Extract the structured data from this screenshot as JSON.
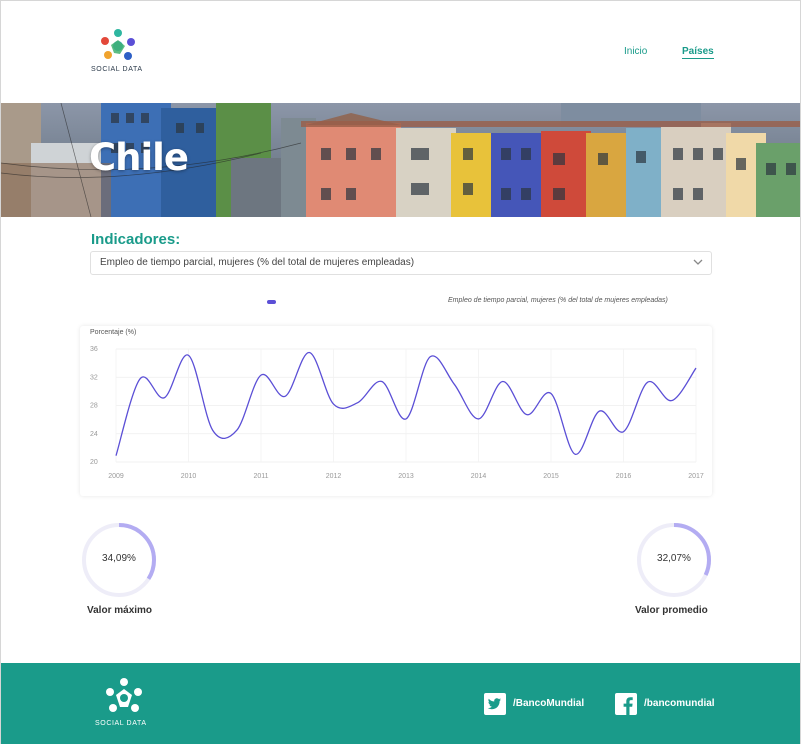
{
  "brand": {
    "logo_text": "SOCIAL DATA",
    "accent": "#1a9b8a",
    "line_color": "#5b4fd6",
    "gauge_color": "#b3acf2"
  },
  "nav": {
    "inicio": "Inicio",
    "paises": "Países"
  },
  "hero": {
    "title": "Chile"
  },
  "indicators": {
    "label": "Indicadores:",
    "selected": "Empleo de tiempo parcial, mujeres (% del total de mujeres empleadas)",
    "dropdown_icon": "chevron-down-icon"
  },
  "chart_data": {
    "type": "line",
    "ylabel": "Porcentaje (%)",
    "ylim": [
      20,
      36
    ],
    "y_ticks": [
      "36",
      "32",
      "28",
      "24",
      "20"
    ],
    "x_ticks": [
      "2009",
      "2010",
      "2011",
      "2012",
      "2013",
      "2014",
      "2015",
      "2016",
      "2017"
    ],
    "grid": true,
    "legend": "top",
    "series": [
      {
        "name": "Empleo de tiempo parcial, mujeres (% del total de mujeres empleadas)",
        "values": [
          20.9,
          31.8,
          29.1,
          35.1,
          24.5,
          24.5,
          32.3,
          29.3,
          35.5,
          28.2,
          28.4,
          31.4,
          26.1,
          34.9,
          31.0,
          26.1,
          31.4,
          26.7,
          29.7,
          21.1,
          27.2,
          24.3,
          31.3,
          28.7,
          33.3
        ]
      }
    ]
  },
  "stats": {
    "max": {
      "value": "34,09%",
      "label": "Valor máximo",
      "fraction": 0.34
    },
    "avg": {
      "value": "32,07%",
      "label": "Valor promedio",
      "fraction": 0.32
    }
  },
  "footer": {
    "logo_text": "SOCIAL DATA",
    "twitter": "/BancoMundial",
    "facebook": "/bancomundial",
    "twitter_icon": "twitter-icon",
    "facebook_icon": "facebook-icon"
  }
}
